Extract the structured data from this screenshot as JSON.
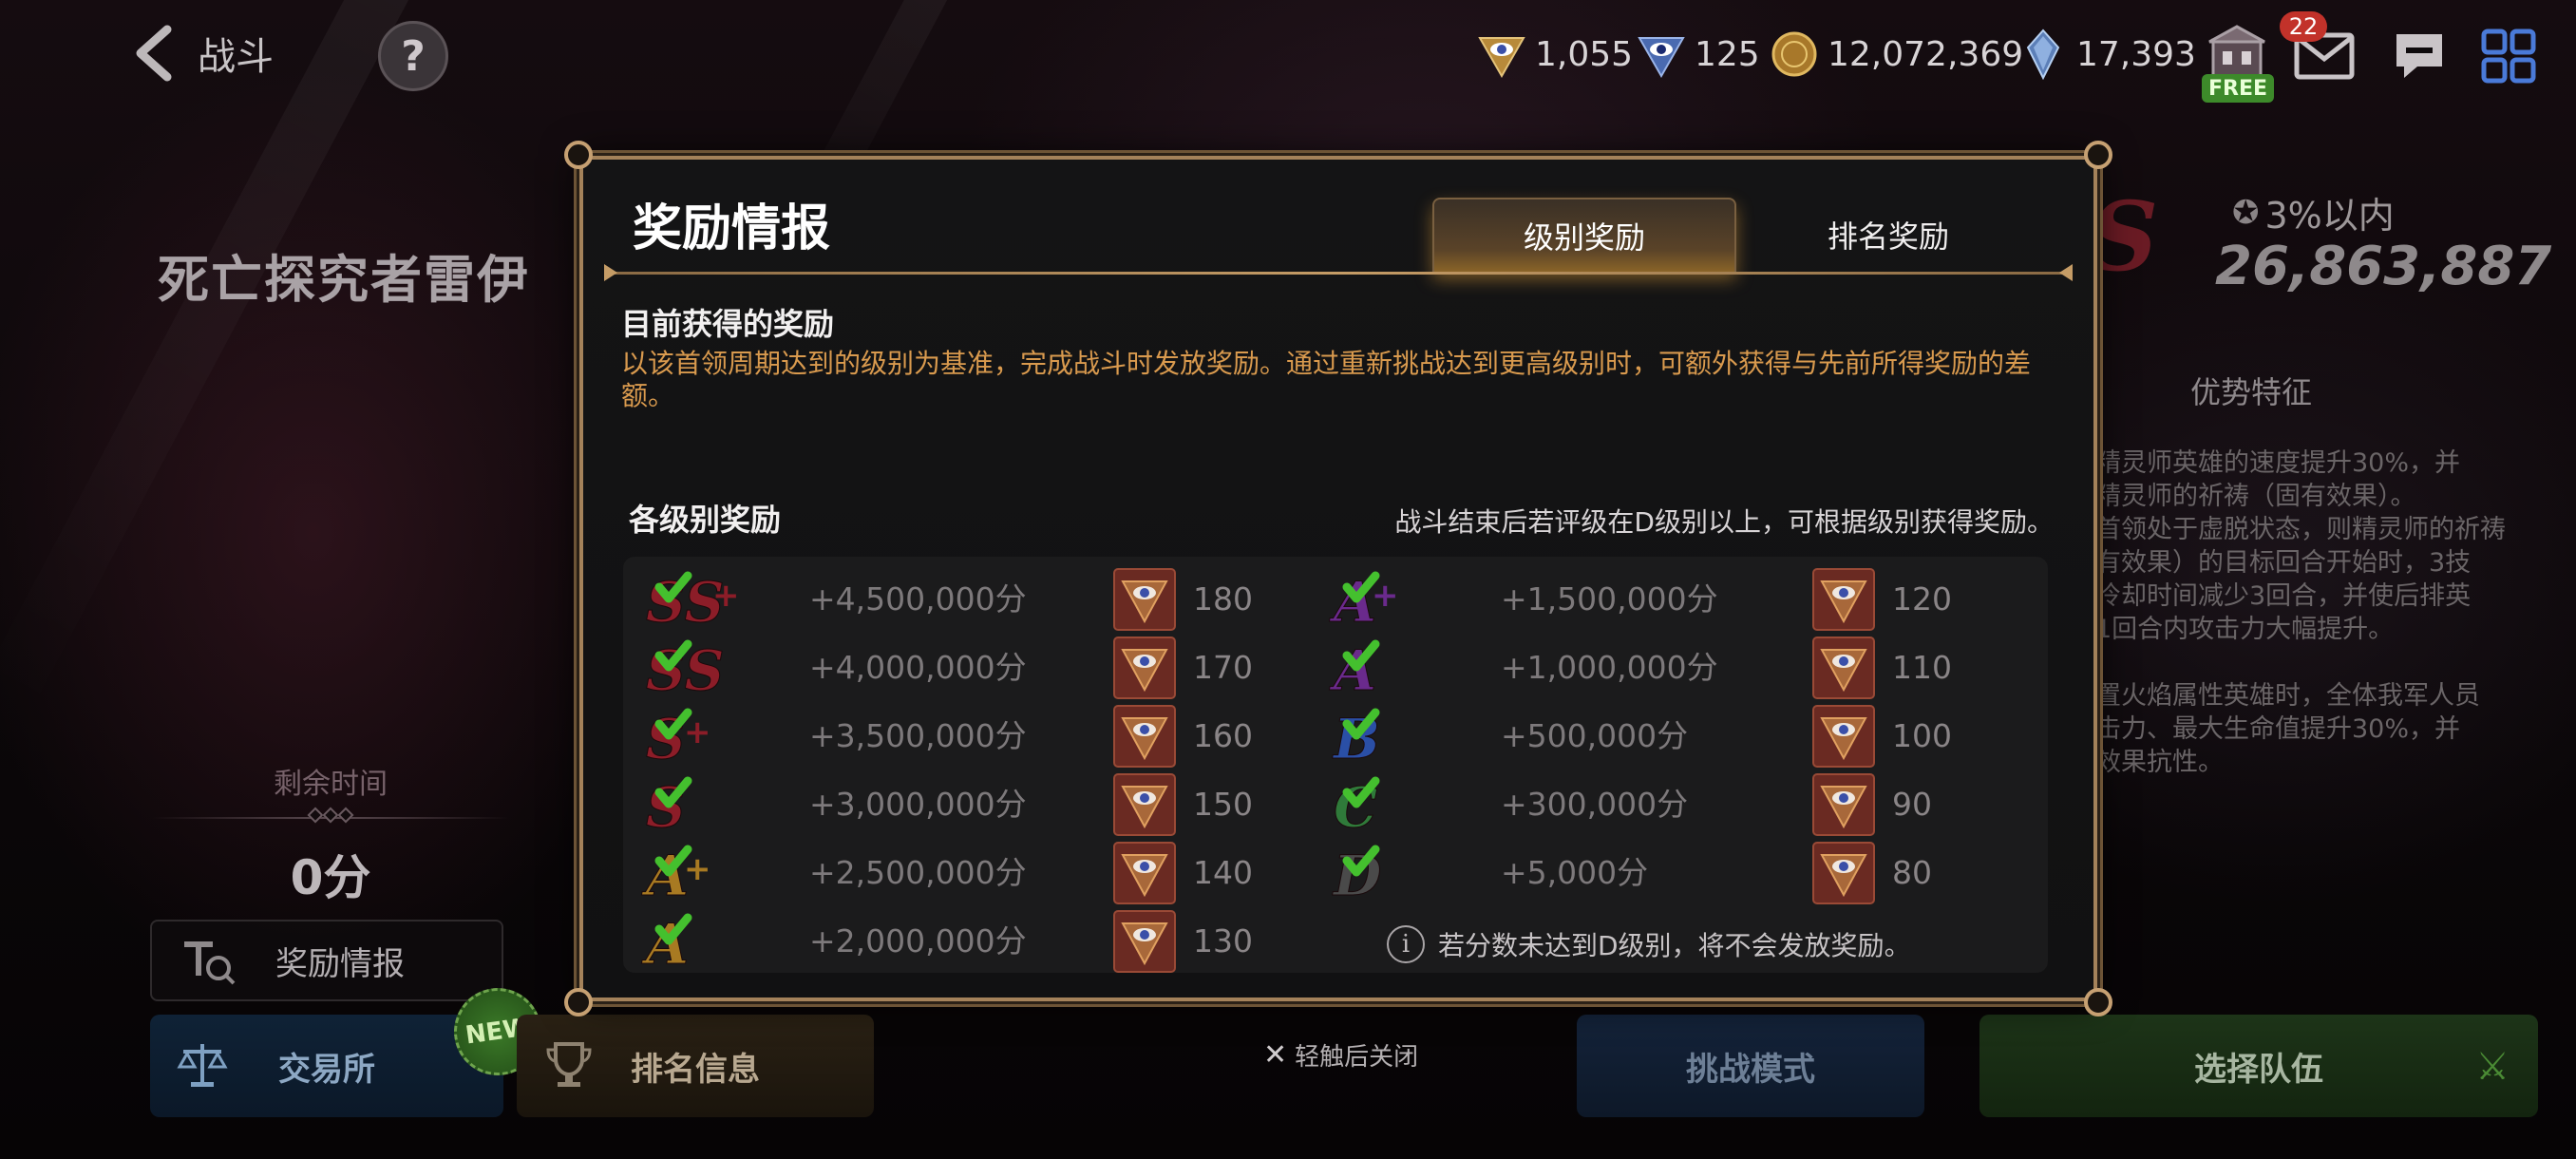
{
  "header": {
    "back_label": "战斗",
    "help_label": "?",
    "resources": [
      {
        "name": "ticket-eye-gold-icon",
        "value": "1,055"
      },
      {
        "name": "ticket-eye-blue-icon",
        "value": "125"
      },
      {
        "name": "gold-coin-icon",
        "value": "12,072,369"
      },
      {
        "name": "crystal-icon",
        "value": "17,393"
      }
    ],
    "free_label": "FREE",
    "mail_count": "22"
  },
  "left": {
    "boss_name": "死亡探究者雷伊",
    "remaining_label": "剩余时间",
    "remaining_value": "0分",
    "reward_info_label": "奖励情报"
  },
  "bottom": {
    "exchange_label": "交易所",
    "new_label": "NEW",
    "ranking_label": "排名信息",
    "close_hint": "轻触后关闭",
    "challenge_label": "挑战模式",
    "select_team_label": "选择队伍"
  },
  "right": {
    "rank_pct": "3%以内",
    "rank_score": "26,863,887",
    "adv_title": "优势特征",
    "adv_text_1": "精灵师英雄的速度提升30%，并",
    "adv_text_2": "精灵师的祈祷（固有效果）。",
    "adv_text_3": "首领处于虚脱状态，则精灵师的祈祷",
    "adv_text_4": "有效果）的目标回合开始时，3技",
    "adv_text_5": "冷却时间减少3回合，并使后排英",
    "adv_text_6": "1回合内攻击力大幅提升。",
    "adv_text_7": "置火焰属性英雄时，全体我军人员",
    "adv_text_8": "击力、最大生命值提升30%，并",
    "adv_text_9": "效果抗性。"
  },
  "modal": {
    "title": "奖励情报",
    "tab_active": "级别奖励",
    "tab_inactive": "排名奖励",
    "current_title": "目前获得的奖励",
    "current_text": "以该首领周期达到的级别为基准，完成战斗时发放奖励。通过重新挑战达到更高级别时，可额外获得与先前所得奖励的差额。",
    "levels_title": "各级别奖励",
    "levels_note": "战斗结束后若评级在D级别以上，可根据级别获得奖励。",
    "left_rows": [
      {
        "rank": "SS+",
        "score": "+4,500,000分",
        "reward": "180"
      },
      {
        "rank": "SS",
        "score": "+4,000,000分",
        "reward": "170"
      },
      {
        "rank": "S+",
        "score": "+3,500,000分",
        "reward": "160"
      },
      {
        "rank": "S",
        "score": "+3,000,000分",
        "reward": "150"
      },
      {
        "rank": "A+",
        "score": "+2,500,000分",
        "reward": "140"
      },
      {
        "rank": "A",
        "score": "+2,000,000分",
        "reward": "130"
      }
    ],
    "right_rows": [
      {
        "rank": "A+",
        "score": "+1,500,000分",
        "reward": "120"
      },
      {
        "rank": "A",
        "score": "+1,000,000分",
        "reward": "110"
      },
      {
        "rank": "B",
        "score": "+500,000分",
        "reward": "100"
      },
      {
        "rank": "C",
        "score": "+300,000分",
        "reward": "90"
      },
      {
        "rank": "D",
        "score": "+5,000分",
        "reward": "80"
      }
    ],
    "info_note": "若分数未达到D级别，将不会发放奖励。"
  }
}
